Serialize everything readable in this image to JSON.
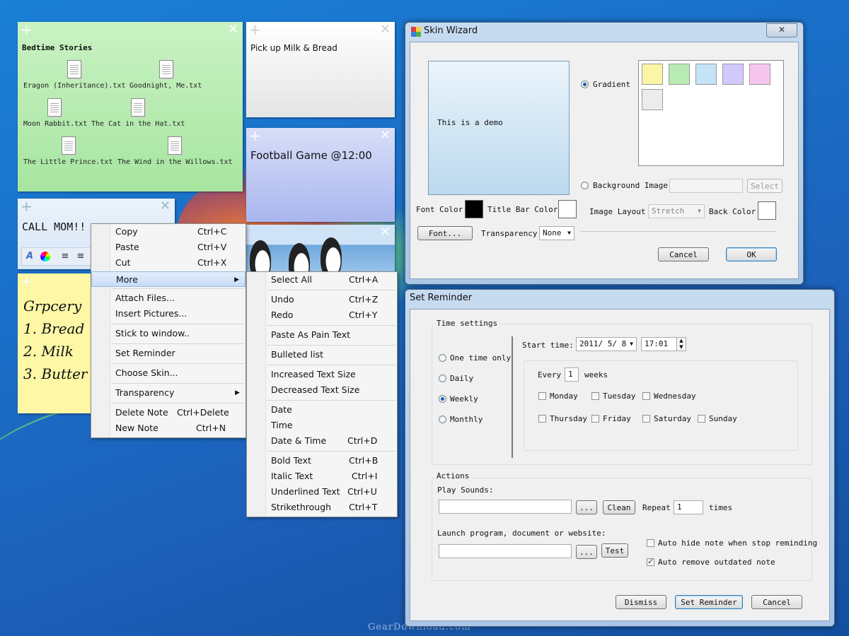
{
  "desktop": {
    "watermark": "GearDownload.com"
  },
  "notes": {
    "bedtime": {
      "title": "Bedtime Stories",
      "files": [
        "Eragon (Inheritance).txt",
        "Goodnight, Me.txt",
        "Moon Rabbit.txt",
        "The Cat in the Hat.txt",
        "The Little Prince.txt",
        "The Wind in the Willows.txt"
      ]
    },
    "milk": {
      "text": "Pick up Milk & Bread"
    },
    "football": {
      "text": "Football Game @12:00"
    },
    "call": {
      "text": "CALL MOM!!"
    },
    "grocery": {
      "lines": [
        "Grpcery",
        "1. Bread",
        "2. Milk",
        "3. Butter"
      ]
    }
  },
  "context_menu": {
    "items": [
      {
        "label": "Copy",
        "shortcut": "Ctrl+C"
      },
      {
        "label": "Paste",
        "shortcut": "Ctrl+V"
      },
      {
        "label": "Cut",
        "shortcut": "Ctrl+X"
      },
      {
        "label": "More",
        "shortcut": ""
      },
      {
        "label": "Attach Files...",
        "shortcut": ""
      },
      {
        "label": "Insert Pictures...",
        "shortcut": ""
      },
      {
        "label": "Stick to window..",
        "shortcut": ""
      },
      {
        "label": "Set Reminder",
        "shortcut": ""
      },
      {
        "label": "Choose Skin...",
        "shortcut": ""
      },
      {
        "label": "Transparency",
        "shortcut": ""
      },
      {
        "label": "Delete Note",
        "shortcut": "Ctrl+Delete"
      },
      {
        "label": "New Note",
        "shortcut": "Ctrl+N"
      }
    ]
  },
  "submenu": {
    "items": [
      {
        "label": "Select All",
        "shortcut": "Ctrl+A"
      },
      {
        "label": "Undo",
        "shortcut": "Ctrl+Z"
      },
      {
        "label": "Redo",
        "shortcut": "Ctrl+Y"
      },
      {
        "label": "Paste As Pain Text",
        "shortcut": ""
      },
      {
        "label": "Bulleted list",
        "shortcut": ""
      },
      {
        "label": "Increased Text Size",
        "shortcut": ""
      },
      {
        "label": "Decreased Text Size",
        "shortcut": ""
      },
      {
        "label": "Date",
        "shortcut": ""
      },
      {
        "label": "Time",
        "shortcut": ""
      },
      {
        "label": "Date & Time",
        "shortcut": "Ctrl+D"
      },
      {
        "label": "Bold Text",
        "shortcut": "Ctrl+B"
      },
      {
        "label": "Italic Text",
        "shortcut": "Ctrl+I"
      },
      {
        "label": "Underlined Text",
        "shortcut": "Ctrl+U"
      },
      {
        "label": "Strikethrough",
        "shortcut": "Ctrl+T"
      }
    ]
  },
  "skin_wizard": {
    "title": "Skin Wizard",
    "close": "✕",
    "preview_text": "This is a demo",
    "gradient_label": "Gradient",
    "gradient_selected": true,
    "swatches": [
      "#fbf5a6",
      "#b8ecb4",
      "#c4e3f7",
      "#d2c8fb",
      "#f7c6ee",
      "#ececec"
    ],
    "background_image_label": "Background Image",
    "select_button": "Select",
    "font_color_label": "Font Color:",
    "font_color": "#000000",
    "title_bar_color_label": "Title Bar Color:",
    "title_bar_color": "#ffffff",
    "image_layout_label": "Image Layout",
    "image_layout_value": "Stretch",
    "back_color_label": "Back Color:",
    "back_color": "#ffffff",
    "font_button": "Font...",
    "transparency_label": "Transparency:",
    "transparency_value": "None",
    "cancel_button": "Cancel",
    "ok_button": "OK"
  },
  "reminder": {
    "title": "Set Reminder",
    "time_settings_label": "Time settings",
    "start_time_label": "Start time:",
    "start_date": "2011/ 5/ 8",
    "start_time": "17:01",
    "frequency": [
      {
        "label": "One time only",
        "selected": false
      },
      {
        "label": "Daily",
        "selected": false
      },
      {
        "label": "Weekly",
        "selected": true
      },
      {
        "label": "Monthly",
        "selected": false
      }
    ],
    "every_label": "Every",
    "every_value": "1",
    "weeks_label": "weeks",
    "days": [
      {
        "label": "Monday",
        "checked": false
      },
      {
        "label": "Tuesday",
        "checked": false
      },
      {
        "label": "Wednesday",
        "checked": false
      },
      {
        "label": "Thursday",
        "checked": false
      },
      {
        "label": "Friday",
        "checked": false
      },
      {
        "label": "Saturday",
        "checked": false
      },
      {
        "label": "Sunday",
        "checked": false
      }
    ],
    "actions_label": "Actions",
    "play_sounds_label": "Play Sounds:",
    "browse_button": "...",
    "clean_button": "Clean",
    "repeat_label": "Repeat",
    "repeat_value": "1",
    "times_label": "times",
    "launch_label": "Launch program, document or website:",
    "test_button": "Test",
    "auto_hide_label": "Auto hide note when stop reminding",
    "auto_hide_checked": false,
    "auto_remove_label": "Auto remove outdated note",
    "auto_remove_checked": true,
    "dismiss_button": "Dismiss",
    "set_button": "Set Reminder",
    "cancel_button": "Cancel"
  }
}
